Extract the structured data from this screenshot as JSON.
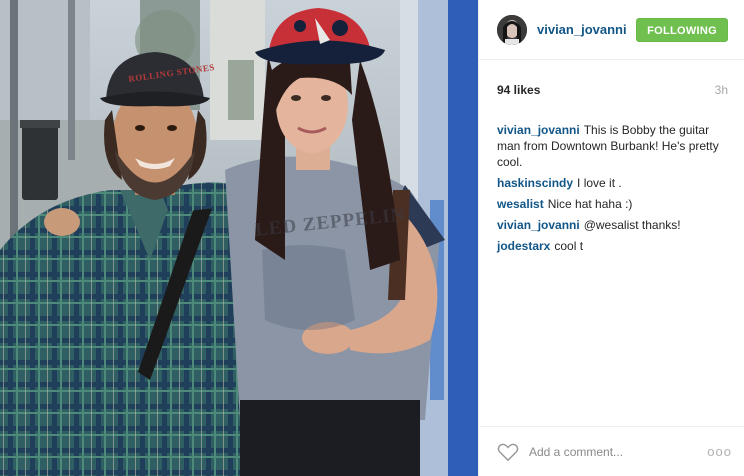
{
  "post": {
    "username": "vivian_jovanni",
    "follow_label": "FOLLOWING",
    "likes": "94 likes",
    "time_ago": "3h",
    "comments": [
      {
        "user": "vivian_jovanni",
        "text": "This is Bobby the guitar man from Downtown Burbank! He's pretty cool."
      },
      {
        "user": "haskinscindy",
        "text": "I love it ."
      },
      {
        "user": "wesalist",
        "text": "Nice hat haha :)"
      },
      {
        "user": "vivian_jovanni",
        "text": "@wesalist thanks!"
      },
      {
        "user": "jodestarx",
        "text": "cool t"
      }
    ],
    "comment_placeholder": "Add a comment...",
    "more_label": "ooo",
    "photo_text": {
      "cap_logo": "ROLLING STONES",
      "shirt_print": "LED ZEPPELIN"
    }
  },
  "colors": {
    "username_blue": "#125688",
    "follow_green": "#70c050",
    "muted_gray": "#a5a7aa",
    "border": "#efefef"
  },
  "icons": [
    "heart-icon",
    "more-options-icon"
  ]
}
